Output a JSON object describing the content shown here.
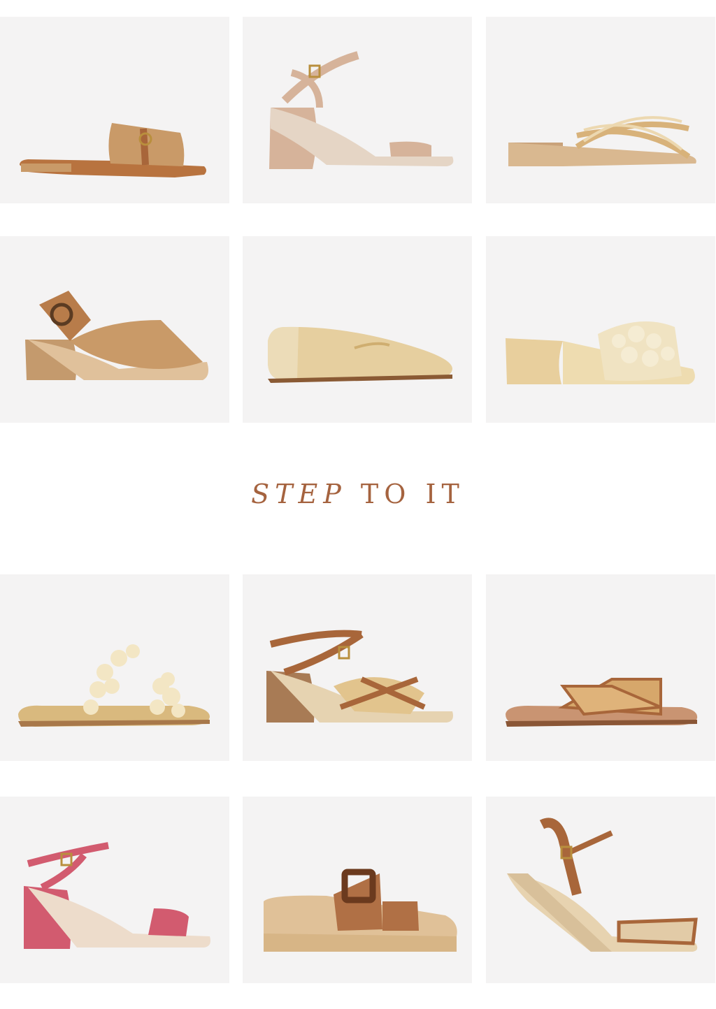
{
  "headline": {
    "emphasis": "STEP",
    "rest": "TO IT"
  },
  "products": [
    {
      "icon": "raffia-slide-sandal-icon"
    },
    {
      "icon": "block-heel-ankle-strap-sandal-icon"
    },
    {
      "icon": "cork-crossover-slide-icon"
    },
    {
      "icon": "crossover-slingback-sandal-icon"
    },
    {
      "icon": "woven-ballet-flat-icon"
    },
    {
      "icon": "fringe-mule-icon"
    },
    {
      "icon": "fringe-flat-sandal-icon"
    },
    {
      "icon": "leather-raffia-heel-sandal-icon"
    },
    {
      "icon": "cane-crossover-slide-icon"
    },
    {
      "icon": "pink-suede-heel-sandal-icon"
    },
    {
      "icon": "tortoise-buckle-platform-icon"
    },
    {
      "icon": "espadrille-wedge-sandal-icon"
    }
  ],
  "colors": {
    "tile_bg": "#f4f3f3",
    "headline": "#a5633f",
    "tan": "#c99a68",
    "cognac": "#a8663a",
    "natural": "#e6cf9f",
    "cream": "#f0e3c2",
    "pink": "#d25b6f",
    "tortoise": "#6b3a1e"
  }
}
